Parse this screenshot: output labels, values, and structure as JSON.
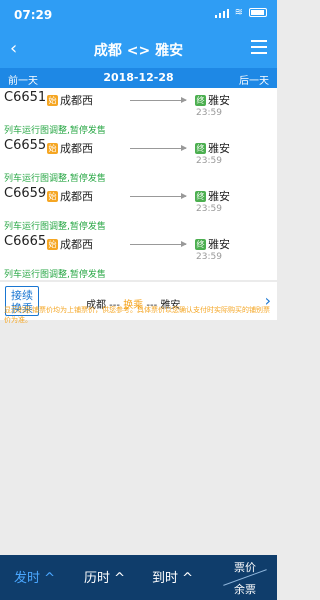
{
  "statusbar": {
    "time": "07:29"
  },
  "header": {
    "title": "成都 <> 雅安",
    "back_icon": "chevron-left",
    "menu_icon": "menu"
  },
  "datebar": {
    "prev": "前一天",
    "date": "2018-12-28",
    "next": "后一天"
  },
  "trains": [
    {
      "no": "C6651",
      "from": "成都西",
      "to": "雅安",
      "arrive": "23:59",
      "notice": "列车运行图调整,暂停发售"
    },
    {
      "no": "C6655",
      "from": "成都西",
      "to": "雅安",
      "arrive": "23:59",
      "notice": "列车运行图调整,暂停发售"
    },
    {
      "no": "C6659",
      "from": "成都西",
      "to": "雅安",
      "arrive": "23:59",
      "notice": "列车运行图调整,暂停发售"
    },
    {
      "no": "C6665",
      "from": "成都西",
      "to": "雅安",
      "arrive": "23:59",
      "notice": "列车运行图调整,暂停发售"
    }
  ],
  "badges": {
    "start": "始",
    "end": "终"
  },
  "transfer": {
    "button_line1": "接续",
    "button_line2": "换乘",
    "from": "成都",
    "sep1": " --- ",
    "mid": "换乘",
    "sep2": " --- ",
    "to": "雅安"
  },
  "disclaimer": "显示的卧铺票价均为上铺票价，供您参考。具体票价以您确认支付时实际购买的铺别票价为准。",
  "bottombar": {
    "depart": "发时",
    "duration": "历时",
    "arrive": "到时",
    "price": "票价",
    "remaining": "余票"
  },
  "colors": {
    "primary": "#2f9df4",
    "accent": "#f5a623",
    "success": "#28a745",
    "bottom_bg": "#0f3d6b"
  }
}
